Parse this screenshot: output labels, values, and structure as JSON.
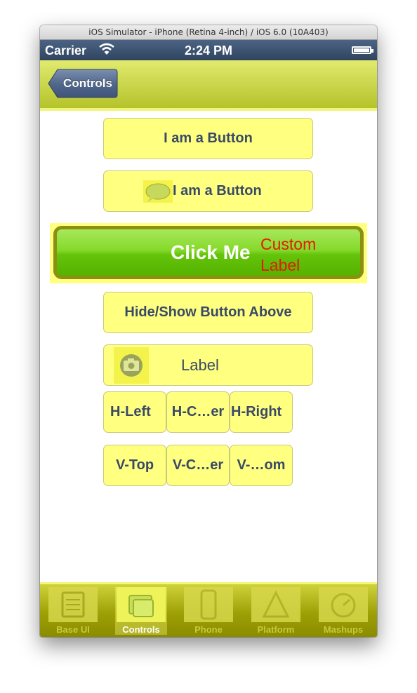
{
  "window": {
    "title": "iOS Simulator - iPhone (Retina 4-inch) / iOS 6.0 (10A403)"
  },
  "statusbar": {
    "carrier": "Carrier",
    "time": "2:24 PM",
    "wifi_icon": "wifi-icon",
    "battery_icon": "battery-icon"
  },
  "navbar": {
    "back_label": "Controls"
  },
  "buttons": {
    "button1": "I am a Button",
    "button2": "I am a Button",
    "click_me": "Click Me",
    "custom_label": "Custom Label",
    "hide_show": "Hide/Show Button Above",
    "camera_label": "Label"
  },
  "h_align": {
    "left": "H-Left",
    "center": "H-C…er",
    "right": "H-Right"
  },
  "v_align": {
    "top": "V-Top",
    "center": "V-C…er",
    "bottom": "V-…om"
  },
  "tabs": [
    {
      "label": "Base UI",
      "icon": "base-ui-icon"
    },
    {
      "label": "Controls",
      "icon": "controls-icon",
      "active": true
    },
    {
      "label": "Phone",
      "icon": "phone-icon"
    },
    {
      "label": "Platform",
      "icon": "platform-icon"
    },
    {
      "label": "Mashups",
      "icon": "mashups-icon"
    }
  ],
  "colors": {
    "navbar": "#c9d23d",
    "button_fill": "#ffff80",
    "button_text": "#3a4a66",
    "click_green": "#72c91b",
    "custom_label": "#e61a00",
    "status_bar": "#3d5272"
  }
}
